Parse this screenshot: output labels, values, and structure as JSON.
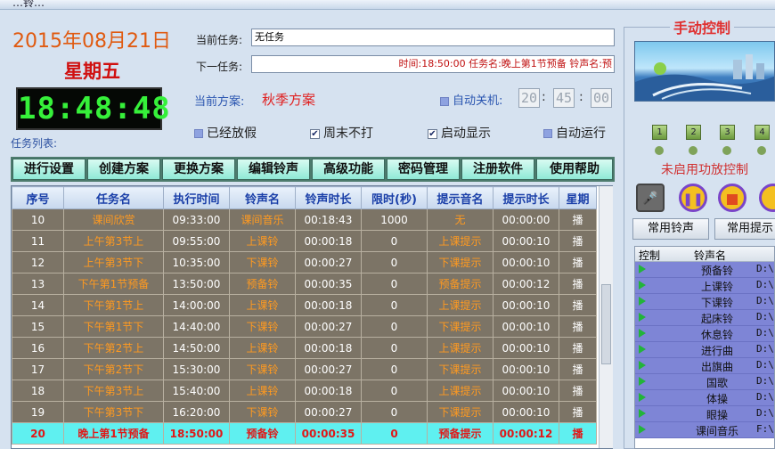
{
  "window": {
    "title_fragment": "…铃…"
  },
  "date_display": "2015年08月21日",
  "weekday_display": "星期五",
  "clock_display": "18:48:48",
  "current_task": {
    "label": "当前任务:",
    "value": "无任务"
  },
  "next_task": {
    "label": "下一任务:",
    "value": "时间:18:50:00  任务名:晚上第1节预备  铃声名:预"
  },
  "current_plan": {
    "label": "当前方案:",
    "value": "秋季方案"
  },
  "auto_shutdown": {
    "label": "自动关机:",
    "hour": "20",
    "minute": "45",
    "second": "00"
  },
  "options": {
    "holiday": "已经放假",
    "weekend_no_ring": "周末不打",
    "startup_display": "启动显示",
    "auto_run": "自动运行",
    "weekend_checked": true,
    "startup_checked": true
  },
  "task_list_label": "任务列表:",
  "toolbar": [
    "进行设置",
    "创建方案",
    "更换方案",
    "编辑铃声",
    "高级功能",
    "密码管理",
    "注册软件",
    "使用帮助"
  ],
  "table": {
    "headers": [
      "序号",
      "任务名",
      "执行时间",
      "铃声名",
      "铃声时长",
      "限时(秒)",
      "提示音名",
      "提示时长",
      "星期"
    ],
    "rows": [
      [
        "10",
        "课间欣赏",
        "09:33:00",
        "课间音乐",
        "00:18:43",
        "1000",
        "无",
        "00:00:00",
        "播"
      ],
      [
        "11",
        "上午第3节上",
        "09:55:00",
        "上课铃",
        "00:00:18",
        "0",
        "上课提示",
        "00:00:10",
        "播"
      ],
      [
        "12",
        "上午第3节下",
        "10:35:00",
        "下课铃",
        "00:00:27",
        "0",
        "下课提示",
        "00:00:10",
        "播"
      ],
      [
        "13",
        "下午第1节预备",
        "13:50:00",
        "预备铃",
        "00:00:35",
        "0",
        "预备提示",
        "00:00:12",
        "播"
      ],
      [
        "14",
        "下午第1节上",
        "14:00:00",
        "上课铃",
        "00:00:18",
        "0",
        "上课提示",
        "00:00:10",
        "播"
      ],
      [
        "15",
        "下午第1节下",
        "14:40:00",
        "下课铃",
        "00:00:27",
        "0",
        "下课提示",
        "00:00:10",
        "播"
      ],
      [
        "16",
        "下午第2节上",
        "14:50:00",
        "上课铃",
        "00:00:18",
        "0",
        "上课提示",
        "00:00:10",
        "播"
      ],
      [
        "17",
        "下午第2节下",
        "15:30:00",
        "下课铃",
        "00:00:27",
        "0",
        "下课提示",
        "00:00:10",
        "播"
      ],
      [
        "18",
        "下午第3节上",
        "15:40:00",
        "上课铃",
        "00:00:18",
        "0",
        "上课提示",
        "00:00:10",
        "播"
      ],
      [
        "19",
        "下午第3节下",
        "16:20:00",
        "下课铃",
        "00:00:27",
        "0",
        "下课提示",
        "00:00:10",
        "播"
      ],
      [
        "20",
        "晚上第1节预备",
        "18:50:00",
        "预备铃",
        "00:00:35",
        "0",
        "预备提示",
        "00:00:12",
        "播"
      ]
    ],
    "selected_row": 10
  },
  "manual_control": {
    "title": "手动控制",
    "channels": [
      "1",
      "2",
      "3",
      "4"
    ],
    "amp_status": "未启用功放控制",
    "common_bells_button": "常用铃声",
    "common_prompts_button": "常用提示",
    "bell_list_headers": [
      "控制",
      "铃声名"
    ],
    "bell_list": [
      {
        "name": "预备铃",
        "path": "D:\\"
      },
      {
        "name": "上课铃",
        "path": "D:\\"
      },
      {
        "name": "下课铃",
        "path": "D:\\"
      },
      {
        "name": "起床铃",
        "path": "D:\\"
      },
      {
        "name": "休息铃",
        "path": "D:\\"
      },
      {
        "name": "进行曲",
        "path": "D:\\"
      },
      {
        "name": "出旗曲",
        "path": "D:\\"
      },
      {
        "name": "国歌",
        "path": "D:\\"
      },
      {
        "name": "体操",
        "path": "D:\\"
      },
      {
        "name": "眼操",
        "path": "D:\\"
      },
      {
        "name": "课间音乐",
        "path": "F:\\"
      }
    ]
  },
  "colors": {
    "accent_orange": "#e05a10",
    "weekday_red": "#d01010",
    "clock_green": "#36f03a",
    "selected_row": "#5ff0f0",
    "row_bg": "#7c7466"
  }
}
